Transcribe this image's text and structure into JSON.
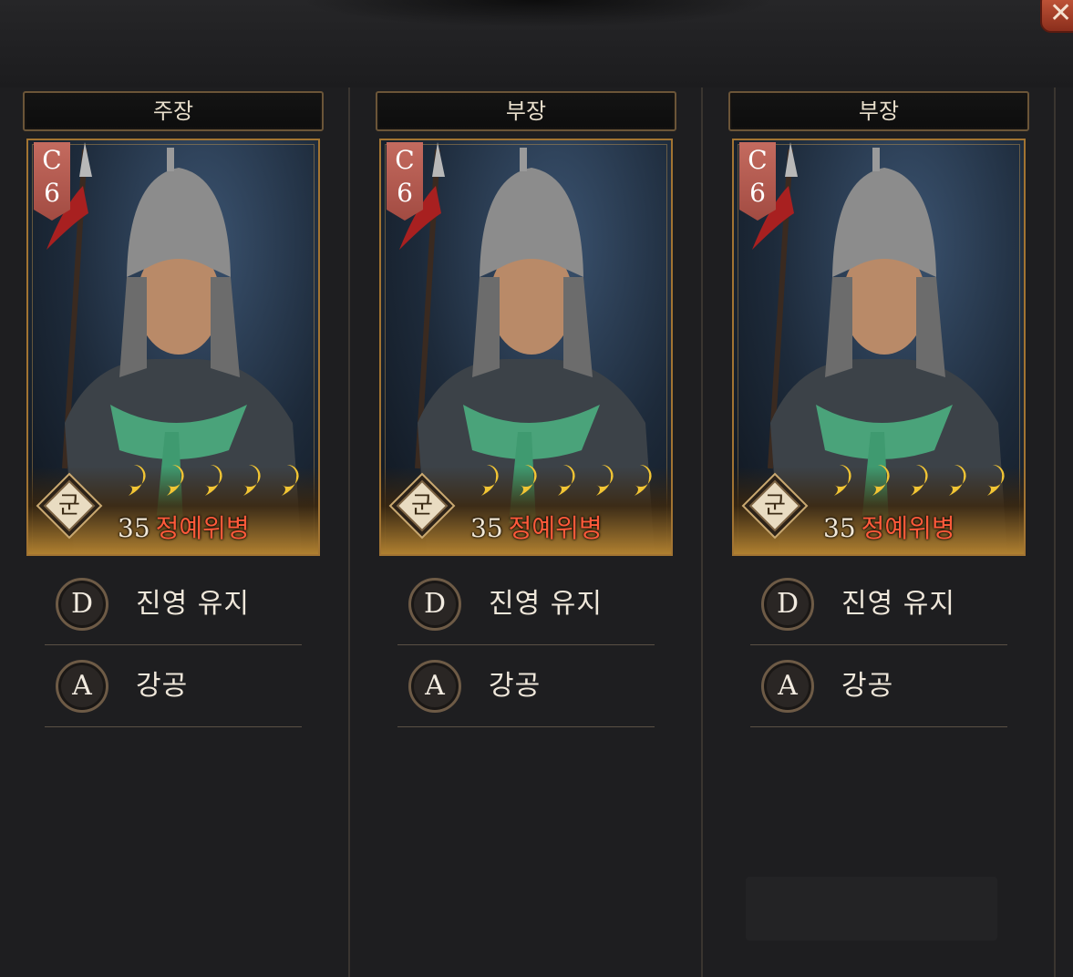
{
  "columns": [
    {
      "role": "주장",
      "card": {
        "grade_letter": "C",
        "grade_number": "6",
        "unit_badge": "군",
        "unit_level": "35",
        "unit_name": "정예위병",
        "drops": 5
      },
      "skills": [
        {
          "badge": "D",
          "name": "진영 유지"
        },
        {
          "badge": "A",
          "name": "강공"
        }
      ]
    },
    {
      "role": "부장",
      "card": {
        "grade_letter": "C",
        "grade_number": "6",
        "unit_badge": "군",
        "unit_level": "35",
        "unit_name": "정예위병",
        "drops": 5
      },
      "skills": [
        {
          "badge": "D",
          "name": "진영 유지"
        },
        {
          "badge": "A",
          "name": "강공"
        }
      ]
    },
    {
      "role": "부장",
      "card": {
        "grade_letter": "C",
        "grade_number": "6",
        "unit_badge": "군",
        "unit_level": "35",
        "unit_name": "정예위병",
        "drops": 5
      },
      "skills": [
        {
          "badge": "D",
          "name": "진영 유지"
        },
        {
          "badge": "A",
          "name": "강공"
        }
      ]
    }
  ],
  "icons": {
    "close": "close-icon",
    "drop": "drop-icon",
    "unit": "diamond-badge-icon"
  },
  "colors": {
    "unit_name": "#ff5a3a",
    "grade_banner": "#b85a50",
    "gold_frame": "#a27432"
  }
}
